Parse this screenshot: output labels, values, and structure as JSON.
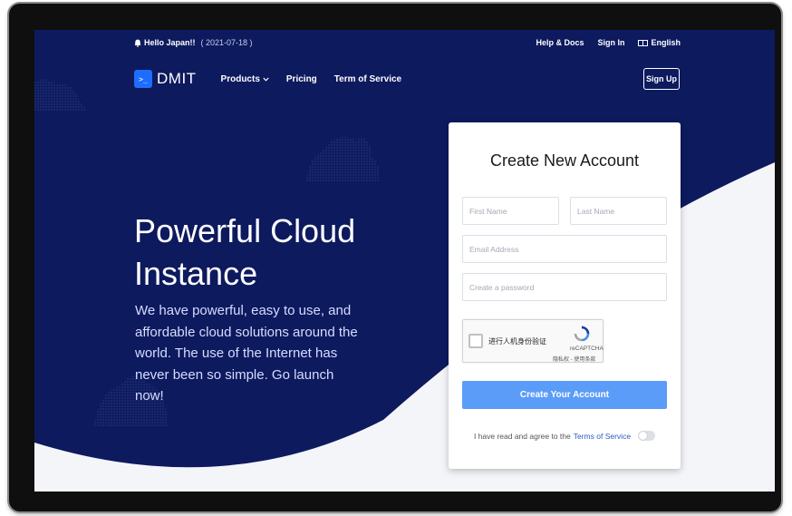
{
  "notice": {
    "text": "Hello Japan!!",
    "date": "( 2021-07-18 )",
    "icon": "bell-icon"
  },
  "top_links": {
    "help": "Help & Docs",
    "signin": "Sign In",
    "language": "English"
  },
  "nav": {
    "logo_mark": ">_",
    "logo_text": "DMIT",
    "products": "Products",
    "pricing": "Pricing",
    "tos": "Term of Service",
    "signup": "Sign Up"
  },
  "hero": {
    "title_line1": "Powerful Cloud",
    "title_line2": "Instance",
    "text": "We have powerful, easy to use, and affordable cloud solutions around the world. The use of the Internet has never been so simple. Go launch now!"
  },
  "form": {
    "title": "Create New Account",
    "first_name_placeholder": "First Name",
    "last_name_placeholder": "Last Name",
    "email_placeholder": "Email Address",
    "password_placeholder": "Create a password",
    "captcha_label": "进行人机身份验证",
    "captcha_brand": "reCAPTCHA",
    "captcha_links": "隐私权 - 使用条款",
    "submit_label": "Create Your Account",
    "agree_text": "I have read and agree to the",
    "agree_link": "Terms of Service"
  },
  "colors": {
    "background": "#0d1a5e",
    "accent": "#1e6dff",
    "button": "#5b9cf8"
  }
}
